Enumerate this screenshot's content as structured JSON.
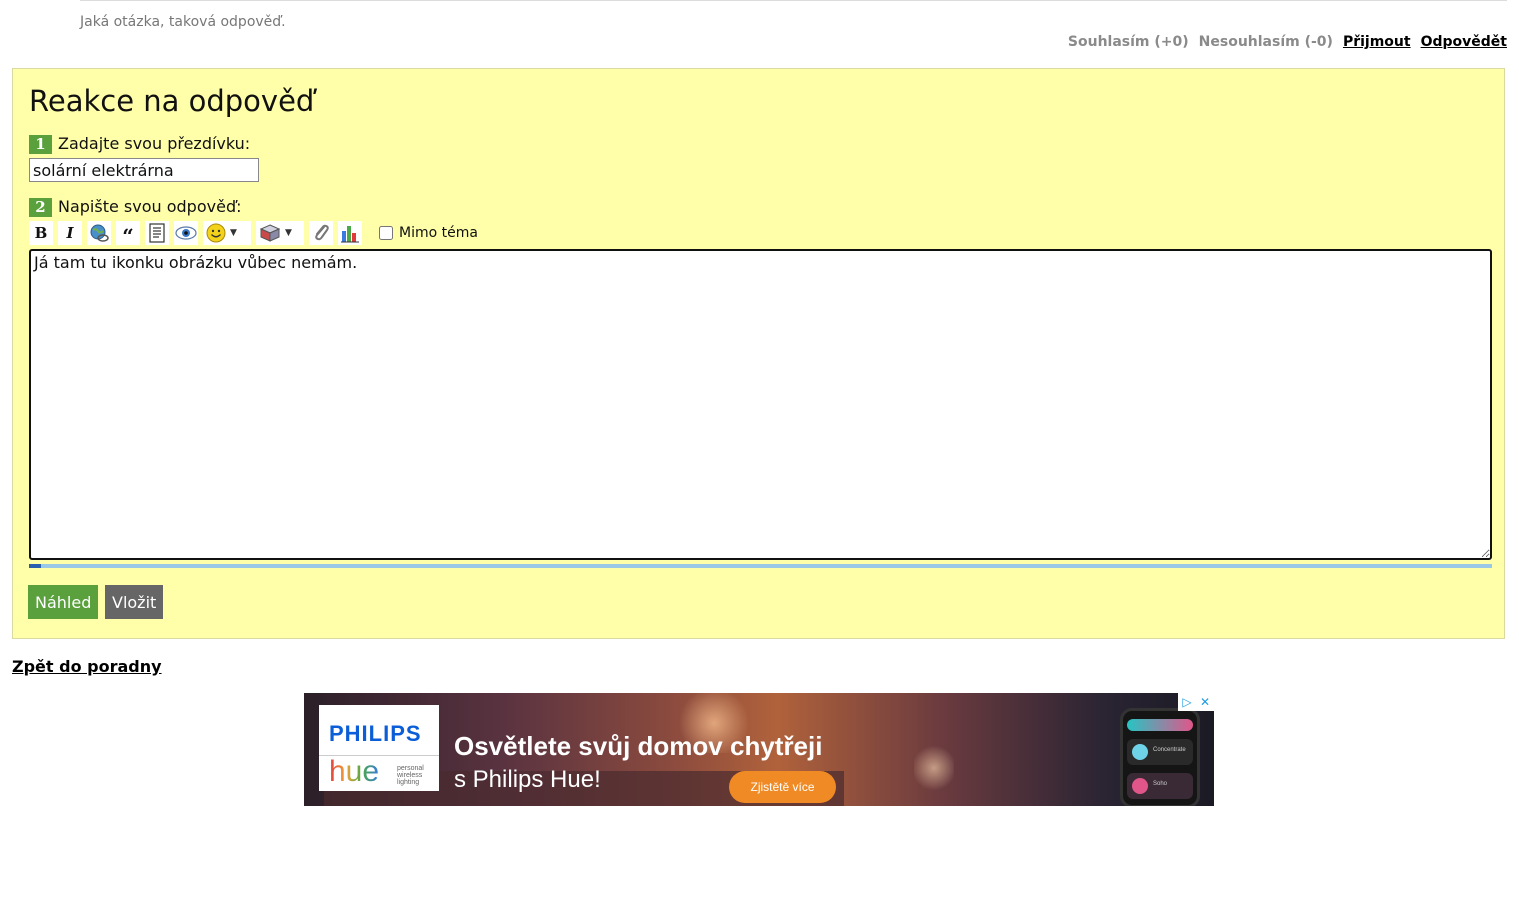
{
  "answer_meta": {
    "signature": "Jaká otázka, taková odpověď.",
    "agree": "Souhlasím (+0)",
    "disagree": "Nesouhlasím (-0)",
    "accept": "Přijmout",
    "reply": "Odpovědět"
  },
  "reply_form": {
    "title": "Reakce na odpověď",
    "step1_number": "1",
    "step1_label": "Zadajte svou přezdívku:",
    "nickname_value": "solární elektrárna",
    "step2_number": "2",
    "step2_label": "Napište svou odpověď:",
    "offtopic_label": "Mimo téma",
    "answer_text": "Já tam tu ikonku obrázku vůbec nemám.",
    "progress_fraction": 0.008,
    "preview_button": "Náhled",
    "submit_button": "Vložit"
  },
  "toolbar": {
    "bold": "B",
    "italic": "I",
    "quote": "“"
  },
  "back_link": "Zpět do poradny",
  "ad": {
    "brand": "PHILIPS",
    "product": "hue",
    "product_sub": "personal wireless lighting",
    "headline": "Osvětlete svůj domov chytřeji",
    "subline": "s Philips Hue!",
    "cta": "Zjistětě více",
    "phone_row1": "Concentrate",
    "phone_row2": "Soho"
  }
}
